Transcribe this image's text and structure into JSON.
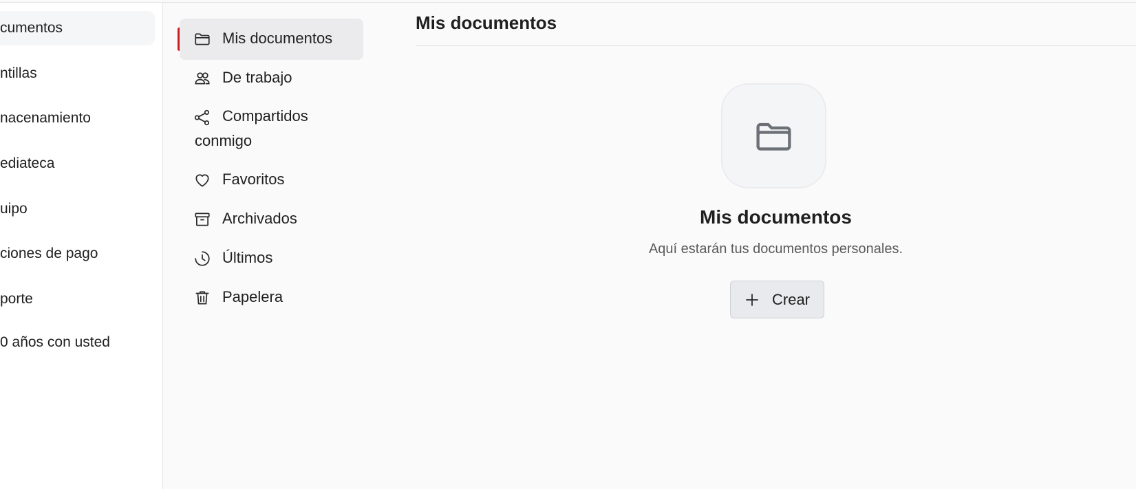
{
  "main_sidebar": {
    "items": [
      {
        "label": "cumentos",
        "active": true
      },
      {
        "label": "ntillas"
      },
      {
        "label": "nacenamiento"
      },
      {
        "label": "ediateca"
      },
      {
        "label": "uipo"
      },
      {
        "label": "ciones de pago"
      },
      {
        "label": "porte"
      },
      {
        "label": "0 años con usted"
      }
    ]
  },
  "sub_sidebar": {
    "items": [
      {
        "label": "Mis documentos",
        "icon": "folder-icon",
        "active": true
      },
      {
        "label": "De trabajo",
        "icon": "users-icon"
      },
      {
        "label": "Compartidos conmigo",
        "icon": "share-icon"
      },
      {
        "label": "Favoritos",
        "icon": "heart-icon"
      },
      {
        "label": "Archivados",
        "icon": "archive-icon"
      },
      {
        "label": "Últimos",
        "icon": "clock-icon"
      },
      {
        "label": "Papelera",
        "icon": "trash-icon"
      }
    ]
  },
  "content": {
    "title": "Mis documentos",
    "empty_state": {
      "icon": "folder-open-icon",
      "title": "Mis documentos",
      "subtitle": "Aquí estarán tus documentos personales.",
      "create_label": "Crear",
      "create_icon": "plus-icon"
    }
  },
  "colors": {
    "accent": "#c81e1e",
    "active_bg": "#ebebee",
    "background": "#fafafa"
  }
}
